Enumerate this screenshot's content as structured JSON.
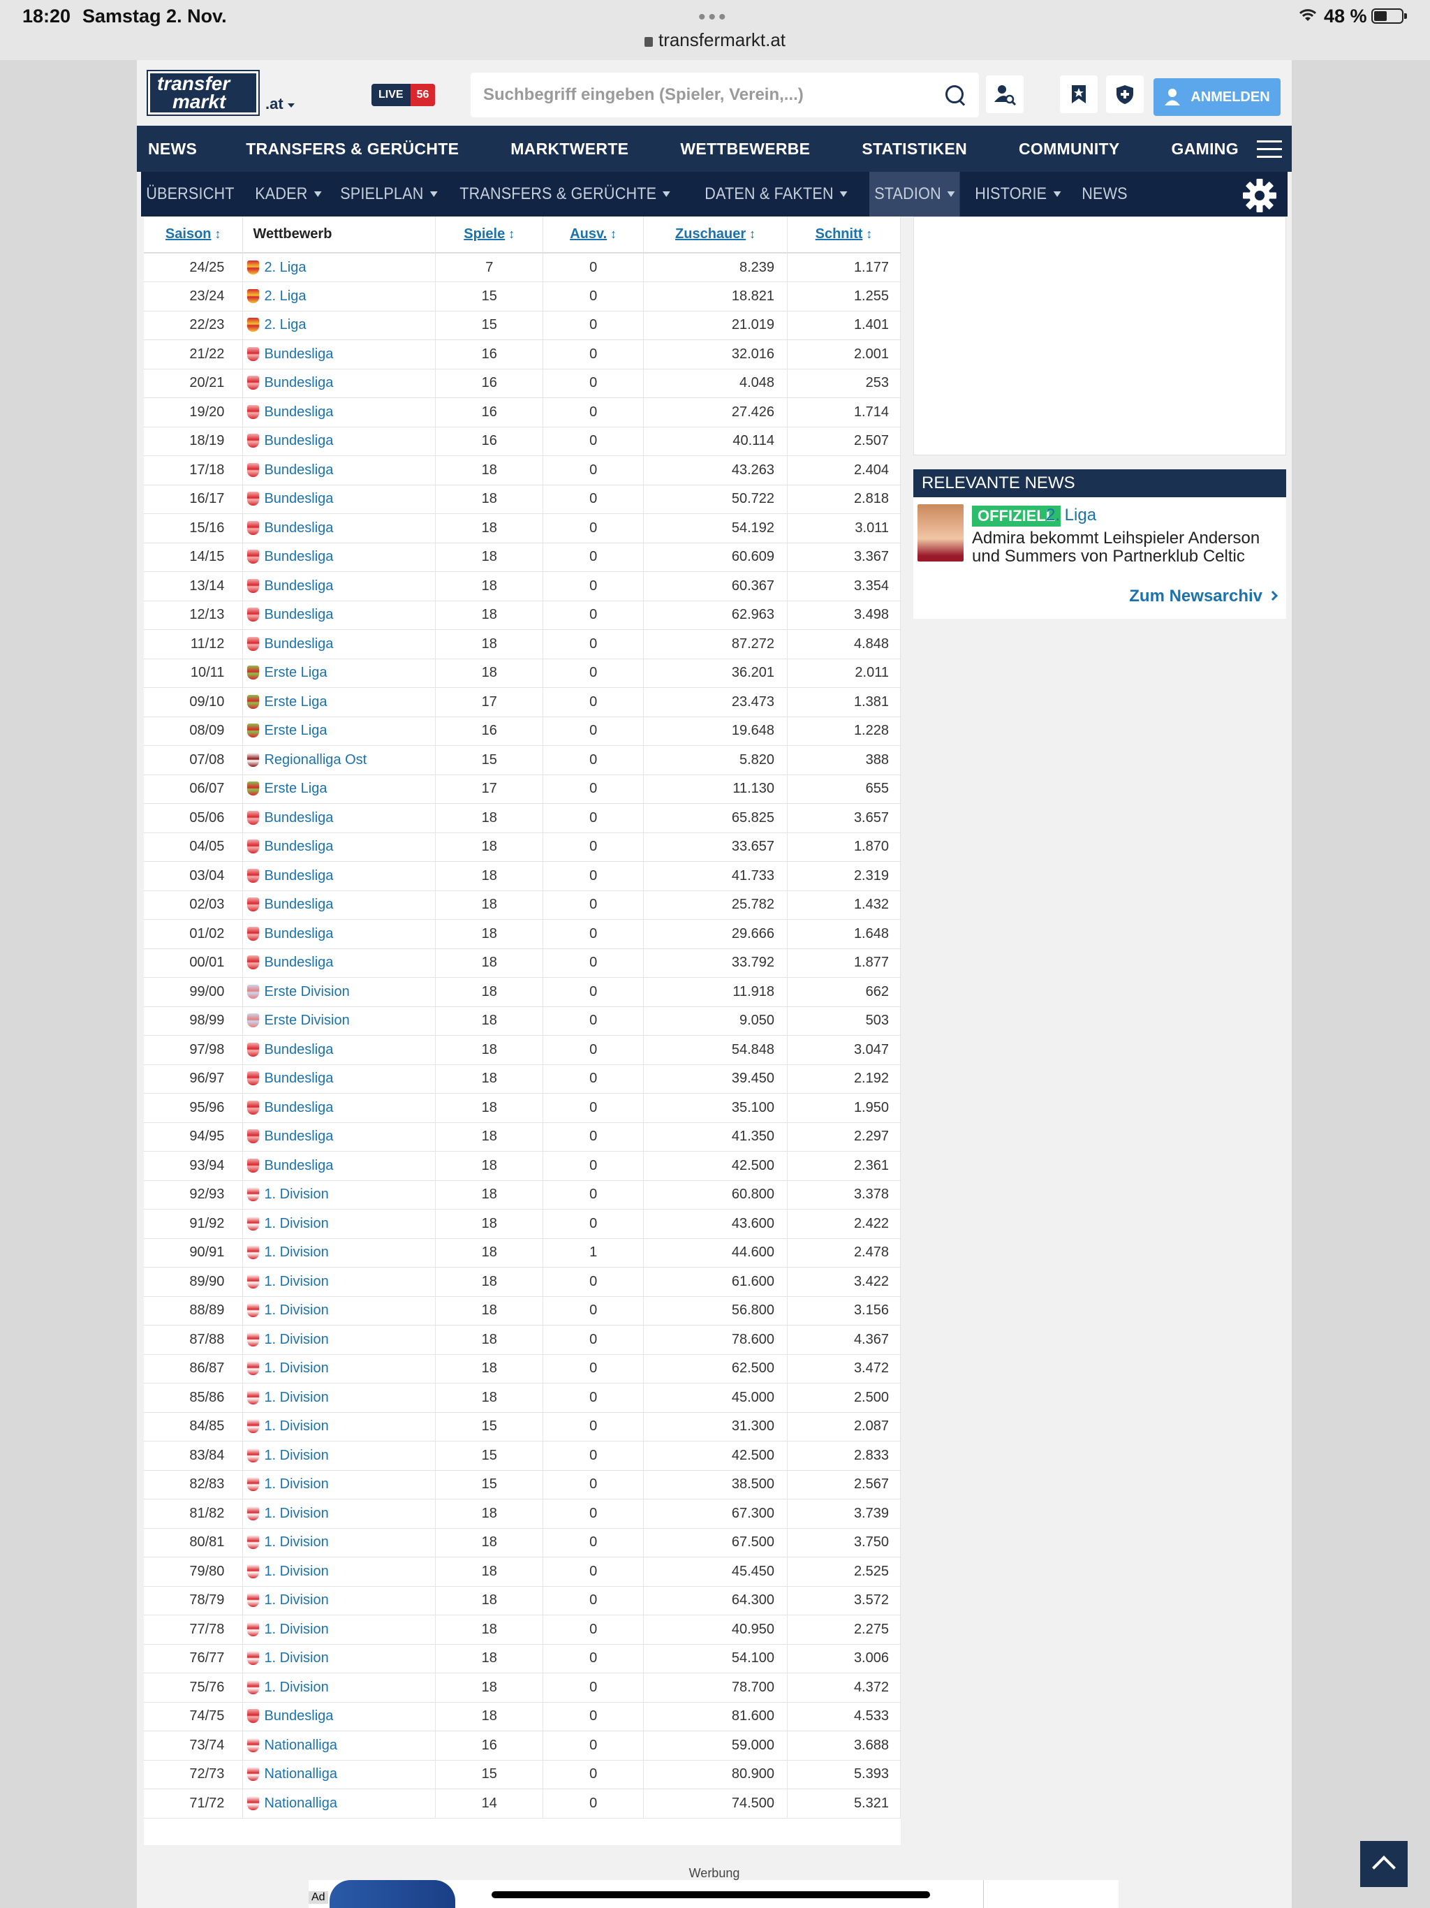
{
  "status": {
    "time": "18:20",
    "date": "Samstag 2. Nov.",
    "battery": "48 %",
    "url": "transfermarkt.at"
  },
  "header": {
    "logo_line1": "transfer",
    "logo_line2": "markt",
    "domain": ".at",
    "live_label": "LIVE",
    "live_count": "56",
    "search_placeholder": "Suchbegriff eingeben (Spieler, Verein,...)",
    "login_label": "ANMELDEN"
  },
  "mainnav": [
    "NEWS",
    "TRANSFERS & GERÜCHTE",
    "MARKTWERTE",
    "WETTBEWERBE",
    "STATISTIKEN",
    "COMMUNITY",
    "GAMING"
  ],
  "subnav": [
    {
      "label": "ÜBERSICHT",
      "caret": false
    },
    {
      "label": "KADER",
      "caret": true
    },
    {
      "label": "SPIELPLAN",
      "caret": true
    },
    {
      "label": "TRANSFERS & GERÜCHTE",
      "caret": true
    },
    {
      "label": "DATEN & FAKTEN",
      "caret": true
    },
    {
      "label": "STADION",
      "caret": true,
      "active": true
    },
    {
      "label": "HISTORIE",
      "caret": true
    },
    {
      "label": "NEWS",
      "caret": false
    }
  ],
  "table": {
    "headers": {
      "season": "Saison",
      "competition": "Wettbewerb",
      "games": "Spiele",
      "sold_out": "Ausv.",
      "spectators": "Zuschauer",
      "average": "Schnitt"
    },
    "rows": [
      [
        "24/25",
        "2. Liga",
        "7",
        "0",
        "8.239",
        "1.177"
      ],
      [
        "23/24",
        "2. Liga",
        "15",
        "0",
        "18.821",
        "1.255"
      ],
      [
        "22/23",
        "2. Liga",
        "15",
        "0",
        "21.019",
        "1.401"
      ],
      [
        "21/22",
        "Bundesliga",
        "16",
        "0",
        "32.016",
        "2.001"
      ],
      [
        "20/21",
        "Bundesliga",
        "16",
        "0",
        "4.048",
        "253"
      ],
      [
        "19/20",
        "Bundesliga",
        "16",
        "0",
        "27.426",
        "1.714"
      ],
      [
        "18/19",
        "Bundesliga",
        "16",
        "0",
        "40.114",
        "2.507"
      ],
      [
        "17/18",
        "Bundesliga",
        "18",
        "0",
        "43.263",
        "2.404"
      ],
      [
        "16/17",
        "Bundesliga",
        "18",
        "0",
        "50.722",
        "2.818"
      ],
      [
        "15/16",
        "Bundesliga",
        "18",
        "0",
        "54.192",
        "3.011"
      ],
      [
        "14/15",
        "Bundesliga",
        "18",
        "0",
        "60.609",
        "3.367"
      ],
      [
        "13/14",
        "Bundesliga",
        "18",
        "0",
        "60.367",
        "3.354"
      ],
      [
        "12/13",
        "Bundesliga",
        "18",
        "0",
        "62.963",
        "3.498"
      ],
      [
        "11/12",
        "Bundesliga",
        "18",
        "0",
        "87.272",
        "4.848"
      ],
      [
        "10/11",
        "Erste Liga",
        "18",
        "0",
        "36.201",
        "2.011"
      ],
      [
        "09/10",
        "Erste Liga",
        "17",
        "0",
        "23.473",
        "1.381"
      ],
      [
        "08/09",
        "Erste Liga",
        "16",
        "0",
        "19.648",
        "1.228"
      ],
      [
        "07/08",
        "Regionalliga Ost",
        "15",
        "0",
        "5.820",
        "388"
      ],
      [
        "06/07",
        "Erste Liga",
        "17",
        "0",
        "11.130",
        "655"
      ],
      [
        "05/06",
        "Bundesliga",
        "18",
        "0",
        "65.825",
        "3.657"
      ],
      [
        "04/05",
        "Bundesliga",
        "18",
        "0",
        "33.657",
        "1.870"
      ],
      [
        "03/04",
        "Bundesliga",
        "18",
        "0",
        "41.733",
        "2.319"
      ],
      [
        "02/03",
        "Bundesliga",
        "18",
        "0",
        "25.782",
        "1.432"
      ],
      [
        "01/02",
        "Bundesliga",
        "18",
        "0",
        "29.666",
        "1.648"
      ],
      [
        "00/01",
        "Bundesliga",
        "18",
        "0",
        "33.792",
        "1.877"
      ],
      [
        "99/00",
        "Erste Division",
        "18",
        "0",
        "11.918",
        "662"
      ],
      [
        "98/99",
        "Erste Division",
        "18",
        "0",
        "9.050",
        "503"
      ],
      [
        "97/98",
        "Bundesliga",
        "18",
        "0",
        "54.848",
        "3.047"
      ],
      [
        "96/97",
        "Bundesliga",
        "18",
        "0",
        "39.450",
        "2.192"
      ],
      [
        "95/96",
        "Bundesliga",
        "18",
        "0",
        "35.100",
        "1.950"
      ],
      [
        "94/95",
        "Bundesliga",
        "18",
        "0",
        "41.350",
        "2.297"
      ],
      [
        "93/94",
        "Bundesliga",
        "18",
        "0",
        "42.500",
        "2.361"
      ],
      [
        "92/93",
        "1. Division",
        "18",
        "0",
        "60.800",
        "3.378"
      ],
      [
        "91/92",
        "1. Division",
        "18",
        "0",
        "43.600",
        "2.422"
      ],
      [
        "90/91",
        "1. Division",
        "18",
        "1",
        "44.600",
        "2.478"
      ],
      [
        "89/90",
        "1. Division",
        "18",
        "0",
        "61.600",
        "3.422"
      ],
      [
        "88/89",
        "1. Division",
        "18",
        "0",
        "56.800",
        "3.156"
      ],
      [
        "87/88",
        "1. Division",
        "18",
        "0",
        "78.600",
        "4.367"
      ],
      [
        "86/87",
        "1. Division",
        "18",
        "0",
        "62.500",
        "3.472"
      ],
      [
        "85/86",
        "1. Division",
        "18",
        "0",
        "45.000",
        "2.500"
      ],
      [
        "84/85",
        "1. Division",
        "15",
        "0",
        "31.300",
        "2.087"
      ],
      [
        "83/84",
        "1. Division",
        "15",
        "0",
        "42.500",
        "2.833"
      ],
      [
        "82/83",
        "1. Division",
        "15",
        "0",
        "38.500",
        "2.567"
      ],
      [
        "81/82",
        "1. Division",
        "18",
        "0",
        "67.300",
        "3.739"
      ],
      [
        "80/81",
        "1. Division",
        "18",
        "0",
        "67.500",
        "3.750"
      ],
      [
        "79/80",
        "1. Division",
        "18",
        "0",
        "45.450",
        "2.525"
      ],
      [
        "78/79",
        "1. Division",
        "18",
        "0",
        "64.300",
        "3.572"
      ],
      [
        "77/78",
        "1. Division",
        "18",
        "0",
        "40.950",
        "2.275"
      ],
      [
        "76/77",
        "1. Division",
        "18",
        "0",
        "54.100",
        "3.006"
      ],
      [
        "75/76",
        "1. Division",
        "18",
        "0",
        "78.700",
        "4.372"
      ],
      [
        "74/75",
        "Bundesliga",
        "18",
        "0",
        "81.600",
        "4.533"
      ],
      [
        "73/74",
        "Nationalliga",
        "16",
        "0",
        "59.000",
        "3.688"
      ],
      [
        "72/73",
        "Nationalliga",
        "15",
        "0",
        "80.900",
        "5.393"
      ],
      [
        "71/72",
        "Nationalliga",
        "14",
        "0",
        "74.500",
        "5.321"
      ]
    ]
  },
  "news": {
    "heading": "RELEVANTE NEWS",
    "badge": "OFFIZIELL",
    "league": "2. Liga",
    "title": "Admira bekommt Leihspieler Anderson und Summers von Partnerklub Celtic",
    "archive_link": "Zum Newsarchiv"
  },
  "footer": {
    "ad_caption": "Werbung",
    "ad_label": "Ad"
  },
  "colors": {
    "brand_navy": "#1a3151",
    "link_blue": "#1b72ad",
    "live_red": "#d8272d",
    "login_blue": "#5ca7eb",
    "badge_green": "#2bbd6a"
  }
}
